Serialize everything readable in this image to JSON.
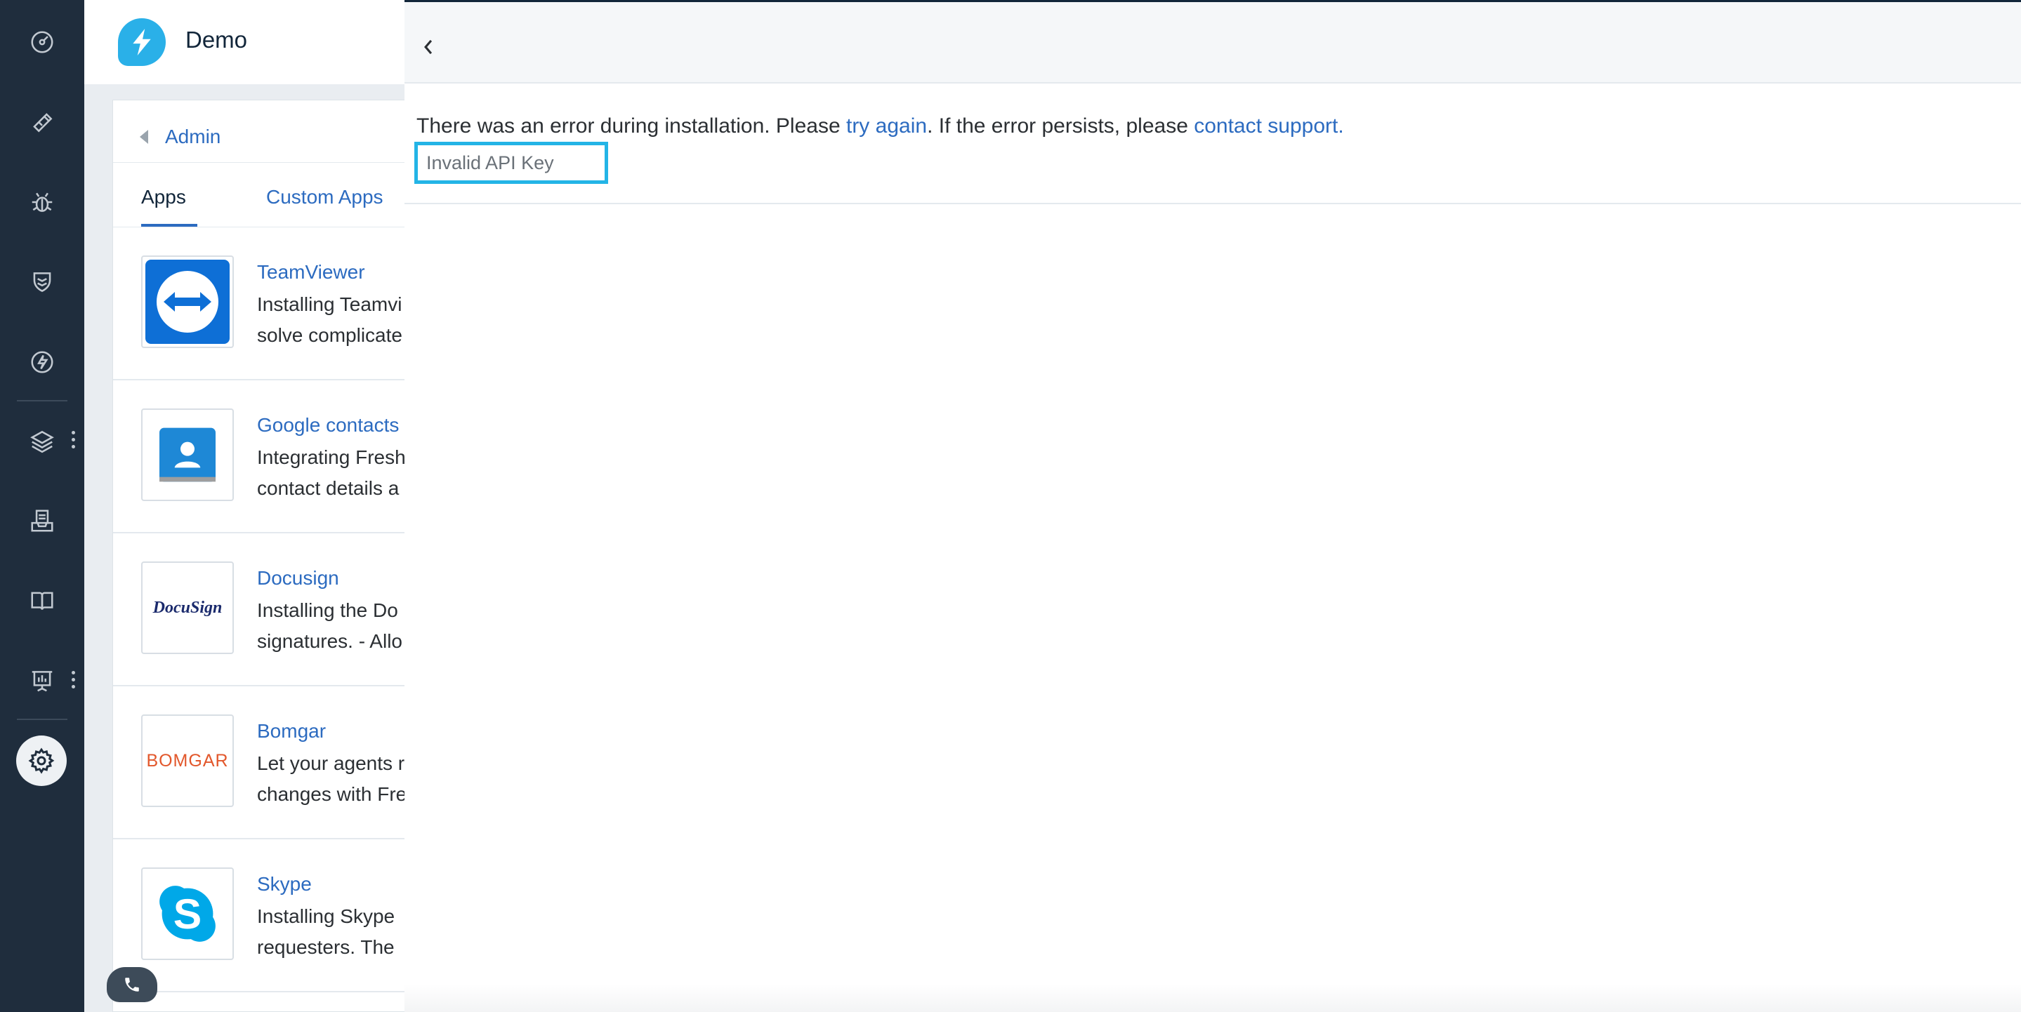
{
  "nav": {
    "items": [
      "dashboard-icon",
      "tickets-icon",
      "problems-icon",
      "changes-icon",
      "releases-icon",
      "assets-icon",
      "inbox-icon",
      "solutions-icon",
      "reports-icon",
      "admin-settings-icon"
    ]
  },
  "header": {
    "brand": "Demo"
  },
  "background_page": {
    "breadcrumb": "Admin",
    "tabs": [
      {
        "label": "Apps",
        "active": true
      },
      {
        "label": "Custom Apps",
        "active": false
      }
    ],
    "apps": [
      {
        "name": "TeamViewer",
        "line1": "Installing Teamvi",
        "line2": "solve complicate"
      },
      {
        "name": "Google contacts",
        "line1": "Integrating Fresh",
        "line2": "contact details a"
      },
      {
        "name": "Docusign",
        "line1": "Installing the Do",
        "line2": "signatures. - Allo"
      },
      {
        "name": "Bomgar",
        "line1": "Let your agents r",
        "line2": "changes with Fre"
      },
      {
        "name": "Skype",
        "line1": "Installing Skype",
        "line2": "requesters. The"
      }
    ],
    "logos": {
      "docusign": "DocuSign",
      "bomgar": "BOMGAR"
    }
  },
  "panel": {
    "error": {
      "before": "There was an error during installation. Please ",
      "retry_link": "try again",
      "middle": ". If the error persists, please ",
      "support_link": "contact support.",
      "detail": "Invalid API Key"
    }
  },
  "colors": {
    "nav_bg": "#1f2d3d",
    "link": "#2c6bc0",
    "highlight": "#23b4e6"
  }
}
